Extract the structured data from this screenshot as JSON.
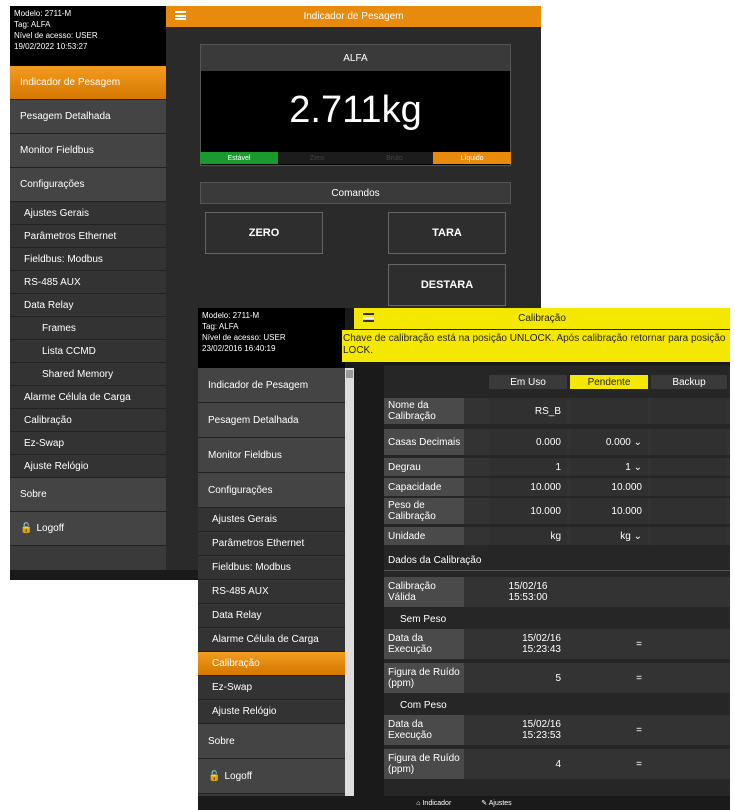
{
  "back": {
    "info": {
      "model": "Modelo: 2711-M",
      "tag": "Tag: ALFA",
      "access": "Nível de acesso: USER",
      "datetime": "19/02/2022 10:53:27"
    },
    "title": "Indicador de Pesagem",
    "sidebar": [
      "Indicador de Pesagem",
      "Pesagem Detalhada",
      "Monitor Fieldbus",
      "Configurações",
      "Ajustes Gerais",
      "Parâmetros Ethernet",
      "Fieldbus: Modbus",
      "RS-485 AUX",
      "Data Relay",
      "Frames",
      "Lista CCMD",
      "Shared Memory",
      "Alarme Célula de Carga",
      "Calibração",
      "Ez-Swap",
      "Ajuste Relógio",
      "Sobre",
      "Logoff"
    ],
    "scale_name": "ALFA",
    "weight": "2.711kg",
    "status": {
      "stable": "Estável",
      "zero": "Zero",
      "gross": "Bruto",
      "net": "Líquido"
    },
    "commands_title": "Comandos",
    "buttons": {
      "zero": "ZERO",
      "tara": "TARA",
      "destara": "DESTARA"
    },
    "colors": {
      "accent": "#e88a0c",
      "stable": "#1a9a2e"
    }
  },
  "front": {
    "info": {
      "model": "Modelo: 2711-M",
      "tag": "Tag: ALFA",
      "access": "Nível de acesso: USER",
      "datetime": "23/02/2016 16:40:19"
    },
    "title": "Calibração",
    "warning": "Chave de calibração está na posição UNLOCK. Após calibração retornar para posição LOCK.",
    "sidebar": [
      "Indicador de Pesagem",
      "Pesagem Detalhada",
      "Monitor Fieldbus",
      "Configurações",
      "Ajustes Gerais",
      "Parâmetros Ethernet",
      "Fieldbus: Modbus",
      "RS-485 AUX",
      "Data Relay",
      "Alarme Célula de Carga",
      "Calibração",
      "Ez-Swap",
      "Ajuste Relógio",
      "Sobre",
      "Logoff"
    ],
    "columns": [
      "Em Uso",
      "Pendente",
      "Backup"
    ],
    "rows": [
      {
        "label": "Nome da Calibração",
        "em_uso": "RS_B",
        "pendente": "",
        "backup": ""
      },
      {
        "label": "Casas Decimais",
        "em_uso": "0.000",
        "pendente": "0.000",
        "backup": ""
      },
      {
        "label": "Degrau",
        "em_uso": "1",
        "pendente": "1",
        "backup": ""
      },
      {
        "label": "Capacidade",
        "em_uso": "10.000",
        "pendente": "10.000",
        "backup": ""
      },
      {
        "label": "Peso de Calibração",
        "em_uso": "10.000",
        "pendente": "10.000",
        "backup": ""
      },
      {
        "label": "Unidade",
        "em_uso": "kg",
        "pendente": "kg",
        "backup": ""
      }
    ],
    "section_cal": "Dados da Calibração",
    "valid": {
      "label": "Calibração Válida",
      "value": "15/02/16 15:53:00"
    },
    "sem_peso": "Sem Peso",
    "sem_rows": [
      {
        "label": "Data da Execução",
        "em_uso": "15/02/16 15:23:43",
        "pendente": "="
      },
      {
        "label": "Figura de Ruído (ppm)",
        "em_uso": "5",
        "pendente": "="
      }
    ],
    "com_peso": "Com Peso",
    "com_rows": [
      {
        "label": "Data da Execução",
        "em_uso": "15/02/16 15:23:53",
        "pendente": "="
      },
      {
        "label": "Figura de Ruído (ppm)",
        "em_uso": "4",
        "pendente": "="
      }
    ],
    "bottom": {
      "indicador": "Indicador",
      "ajustes": "Ajustes"
    },
    "colors": {
      "header": "#f5e800"
    }
  }
}
